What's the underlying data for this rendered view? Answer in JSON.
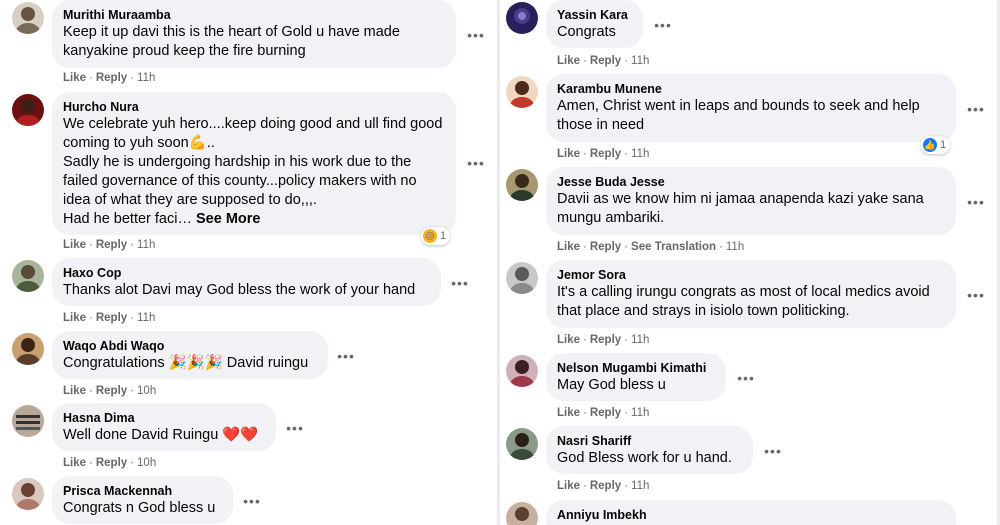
{
  "left_comments": [
    {
      "name": "Murithi Muraamba",
      "text": "Keep it up davi this is the heart of Gold u have made kanyakine proud keep the fire burning",
      "like": "Like",
      "reply": "Reply",
      "time": "11h",
      "avatar_color": "#7a6a58"
    },
    {
      "name": "Hurcho Nura",
      "text": "We celebrate yuh hero....keep doing good and ull find good coming to yuh soon💪..\nSadly he is undergoing hardship in his work due to the failed governance of this county...policy makers with no idea of what they are supposed to do,,,.\nHad he better faci… ",
      "see_more": "See More",
      "like": "Like",
      "reply": "Reply",
      "time": "11h",
      "reaction_count": "1",
      "avatar_color": "#8b1a1a"
    },
    {
      "name": "Haxo Cop",
      "text": "Thanks alot Davi may God bless the work of your hand",
      "like": "Like",
      "reply": "Reply",
      "time": "11h",
      "avatar_color": "#6b7a5a"
    },
    {
      "name": "Waqo Abdi Waqo",
      "text": "Congratulations 🎉🎉🎉 David ruingu",
      "like": "Like",
      "reply": "Reply",
      "time": "10h",
      "avatar_color": "#5a3d2b"
    },
    {
      "name": "Hasna Dima",
      "text": "Well done David Ruingu ❤️❤️",
      "like": "Like",
      "reply": "Reply",
      "time": "10h",
      "avatar_color": "#9a8a7a"
    },
    {
      "name": "Prisca Mackennah",
      "text": "Congrats n God bless u",
      "avatar_color": "#b07a6a"
    }
  ],
  "right_comments": [
    {
      "name": "Yassin Kara",
      "text": "Congrats",
      "like": "Like",
      "reply": "Reply",
      "time": "11h",
      "avatar_color": "#2a1f5a"
    },
    {
      "name": "Karambu Munene",
      "text": "Amen, Christ went in leaps and bounds to seek and help those in need",
      "like": "Like",
      "reply": "Reply",
      "time": "11h",
      "reaction_count": "1",
      "avatar_color": "#c0392b"
    },
    {
      "name": "Jesse Buda Jesse",
      "text": "Davii as we know him ni jamaa anapenda kazi yake sana mungu ambariki.",
      "like": "Like",
      "reply": "Reply",
      "translate": "See Translation",
      "time": "11h",
      "avatar_color": "#6a5a3a"
    },
    {
      "name": "Jemor Sora",
      "text": "It's a calling irungu congrats as most of local medics avoid that place and strays in isiolo town politicking.",
      "like": "Like",
      "reply": "Reply",
      "time": "11h",
      "avatar_color": "#8a8a8a"
    },
    {
      "name": "Nelson Mugambi Kimathi",
      "text": "May God bless u",
      "like": "Like",
      "reply": "Reply",
      "time": "11h",
      "avatar_color": "#a0384a"
    },
    {
      "name": "Nasri Shariff",
      "text": "God Bless work for u hand.",
      "like": "Like",
      "reply": "Reply",
      "time": "11h",
      "avatar_color": "#3a4a3a"
    },
    {
      "name": "Anniyu Imbekh",
      "avatar_color": "#5a4030"
    }
  ],
  "more_options_glyph": "•••",
  "colors": {
    "bubble": "#f0f2f5",
    "meta": "#65676b",
    "like_blue": "#1877f2",
    "divider": "#e9ebee"
  }
}
